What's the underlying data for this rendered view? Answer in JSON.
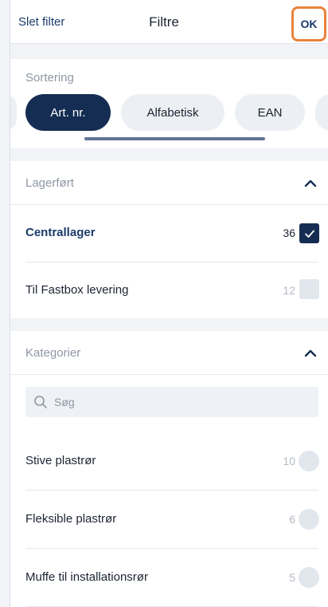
{
  "header": {
    "clear_filter": "Slet filter",
    "title": "Filtre",
    "ok": "OK"
  },
  "sorting": {
    "label": "Sortering",
    "options": [
      "Art. nr.",
      "Alfabetisk",
      "EAN"
    ],
    "selected": "Art. nr."
  },
  "stock": {
    "label": "Lagerført",
    "items": [
      {
        "label": "Centrallager",
        "count": "36",
        "checked": true
      },
      {
        "label": "Til Fastbox levering",
        "count": "12",
        "checked": false
      }
    ]
  },
  "categories": {
    "label": "Kategorier",
    "search_placeholder": "Søg",
    "items": [
      {
        "label": "Stive plastrør",
        "count": "10"
      },
      {
        "label": "Fleksible plastrør",
        "count": "6"
      },
      {
        "label": "Muffe til installationsrør",
        "count": "5"
      }
    ]
  },
  "colors": {
    "accent": "#152d52",
    "highlight_border": "#e8833a"
  },
  "icons": [
    "chevron-up-icon",
    "checkmark-icon",
    "search-icon"
  ]
}
